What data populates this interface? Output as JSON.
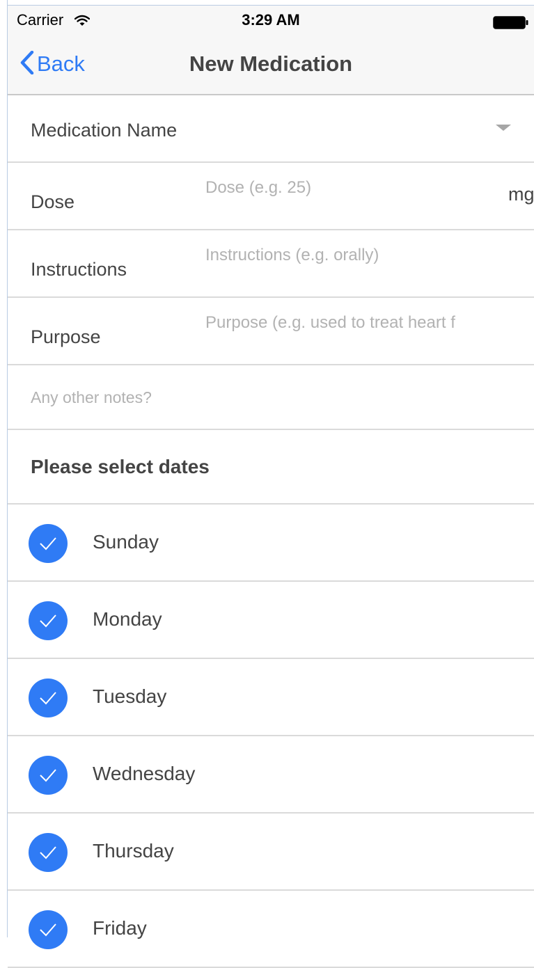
{
  "status_bar": {
    "carrier": "Carrier",
    "time": "3:29 AM",
    "icons": [
      "wifi-icon",
      "battery-icon"
    ]
  },
  "nav": {
    "back_label": "Back",
    "title": "New Medication",
    "back_icon": "chevron-left-icon"
  },
  "form": {
    "medication_name": {
      "label": "Medication Name",
      "icon": "dropdown-caret-icon"
    },
    "dose": {
      "label": "Dose",
      "placeholder": "Dose (e.g. 25)",
      "value": "",
      "unit": "mg"
    },
    "instructions": {
      "label": "Instructions",
      "placeholder": "Instructions (e.g. orally)",
      "value": ""
    },
    "purpose": {
      "label": "Purpose",
      "placeholder": "Purpose (e.g. used to treat heart f",
      "value": ""
    },
    "notes": {
      "placeholder": "Any other notes?",
      "value": ""
    }
  },
  "dates": {
    "heading": "Please select dates",
    "days": [
      {
        "label": "Sunday",
        "checked": true
      },
      {
        "label": "Monday",
        "checked": true
      },
      {
        "label": "Tuesday",
        "checked": true
      },
      {
        "label": "Wednesday",
        "checked": true
      },
      {
        "label": "Thursday",
        "checked": true
      },
      {
        "label": "Friday",
        "checked": true
      }
    ]
  },
  "colors": {
    "accent": "#2f7bf5",
    "text": "#444444",
    "placeholder": "#b2b2b2",
    "divider": "#dadada",
    "bar_background": "#f7f7f7"
  }
}
